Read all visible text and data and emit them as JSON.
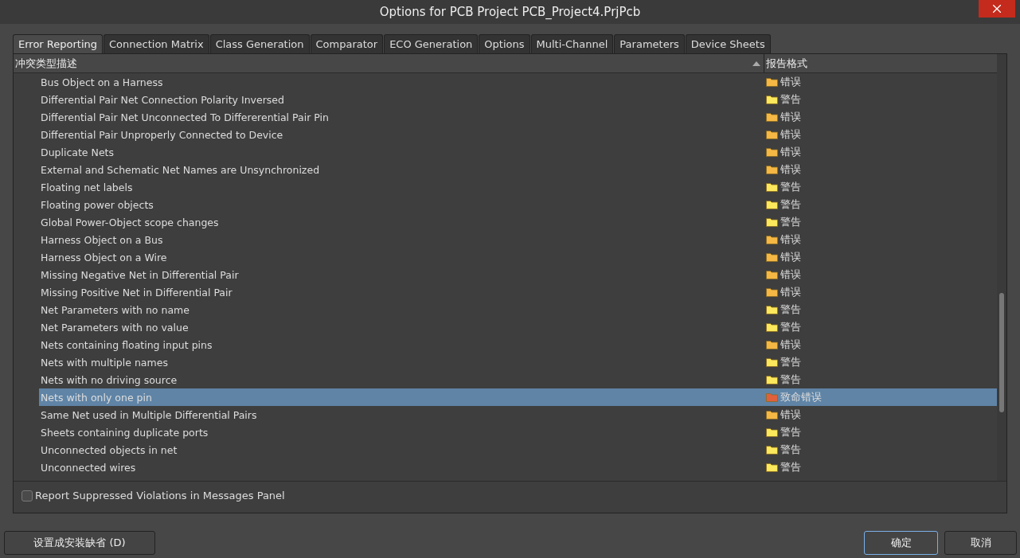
{
  "window": {
    "title": "Options for PCB Project PCB_Project4.PrjPcb"
  },
  "tabs": [
    {
      "label": "Error Reporting",
      "selected": true
    },
    {
      "label": "Connection Matrix",
      "selected": false
    },
    {
      "label": "Class Generation",
      "selected": false
    },
    {
      "label": "Comparator",
      "selected": false
    },
    {
      "label": "ECO Generation",
      "selected": false
    },
    {
      "label": "Options",
      "selected": false
    },
    {
      "label": "Multi-Channel",
      "selected": false
    },
    {
      "label": "Parameters",
      "selected": false
    },
    {
      "label": "Device Sheets",
      "selected": false
    }
  ],
  "table": {
    "columns": [
      "冲突类型描述",
      "报告格式"
    ],
    "rows": [
      {
        "name": "Bus Object on a Harness",
        "format": "错误",
        "color": "#f5b845",
        "selected": false
      },
      {
        "name": "Differential Pair Net Connection Polarity Inversed",
        "format": "警告",
        "color": "#fbe85c",
        "selected": false
      },
      {
        "name": "Differential Pair Net Unconnected To Differerential Pair Pin",
        "format": "错误",
        "color": "#f5b845",
        "selected": false
      },
      {
        "name": "Differential Pair Unproperly Connected to Device",
        "format": "错误",
        "color": "#f5b845",
        "selected": false
      },
      {
        "name": "Duplicate Nets",
        "format": "错误",
        "color": "#f5b845",
        "selected": false
      },
      {
        "name": "External and Schematic Net Names are Unsynchronized",
        "format": "错误",
        "color": "#f5b845",
        "selected": false
      },
      {
        "name": "Floating net labels",
        "format": "警告",
        "color": "#fbe85c",
        "selected": false
      },
      {
        "name": "Floating power objects",
        "format": "警告",
        "color": "#fbe85c",
        "selected": false
      },
      {
        "name": "Global Power-Object scope changes",
        "format": "警告",
        "color": "#fbe85c",
        "selected": false
      },
      {
        "name": "Harness Object on a Bus",
        "format": "错误",
        "color": "#f5b845",
        "selected": false
      },
      {
        "name": "Harness Object on a Wire",
        "format": "错误",
        "color": "#f5b845",
        "selected": false
      },
      {
        "name": "Missing Negative Net in Differential Pair",
        "format": "错误",
        "color": "#f5b845",
        "selected": false
      },
      {
        "name": "Missing Positive Net in Differential Pair",
        "format": "错误",
        "color": "#f5b845",
        "selected": false
      },
      {
        "name": "Net Parameters with no name",
        "format": "警告",
        "color": "#fbe85c",
        "selected": false
      },
      {
        "name": "Net Parameters with no value",
        "format": "警告",
        "color": "#fbe85c",
        "selected": false
      },
      {
        "name": "Nets containing floating input pins",
        "format": "错误",
        "color": "#f5b845",
        "selected": false
      },
      {
        "name": "Nets with multiple names",
        "format": "警告",
        "color": "#fbe85c",
        "selected": false
      },
      {
        "name": "Nets with no driving source",
        "format": "警告",
        "color": "#fbe85c",
        "selected": false
      },
      {
        "name": "Nets with only one pin",
        "format": "致命错误",
        "color": "#e0603c",
        "selected": true
      },
      {
        "name": "Same Net used in Multiple Differential Pairs",
        "format": "错误",
        "color": "#f5b845",
        "selected": false
      },
      {
        "name": "Sheets containing duplicate ports",
        "format": "警告",
        "color": "#fbe85c",
        "selected": false
      },
      {
        "name": "Unconnected objects in net",
        "format": "警告",
        "color": "#fbe85c",
        "selected": false
      },
      {
        "name": "Unconnected wires",
        "format": "警告",
        "color": "#fbe85c",
        "selected": false
      }
    ]
  },
  "report_suppressed": {
    "label": "Report Suppressed Violations in Messages Panel",
    "checked": false
  },
  "buttons": {
    "defaults": "设置成安装缺省 (D)",
    "ok": "确定",
    "cancel": "取消"
  }
}
